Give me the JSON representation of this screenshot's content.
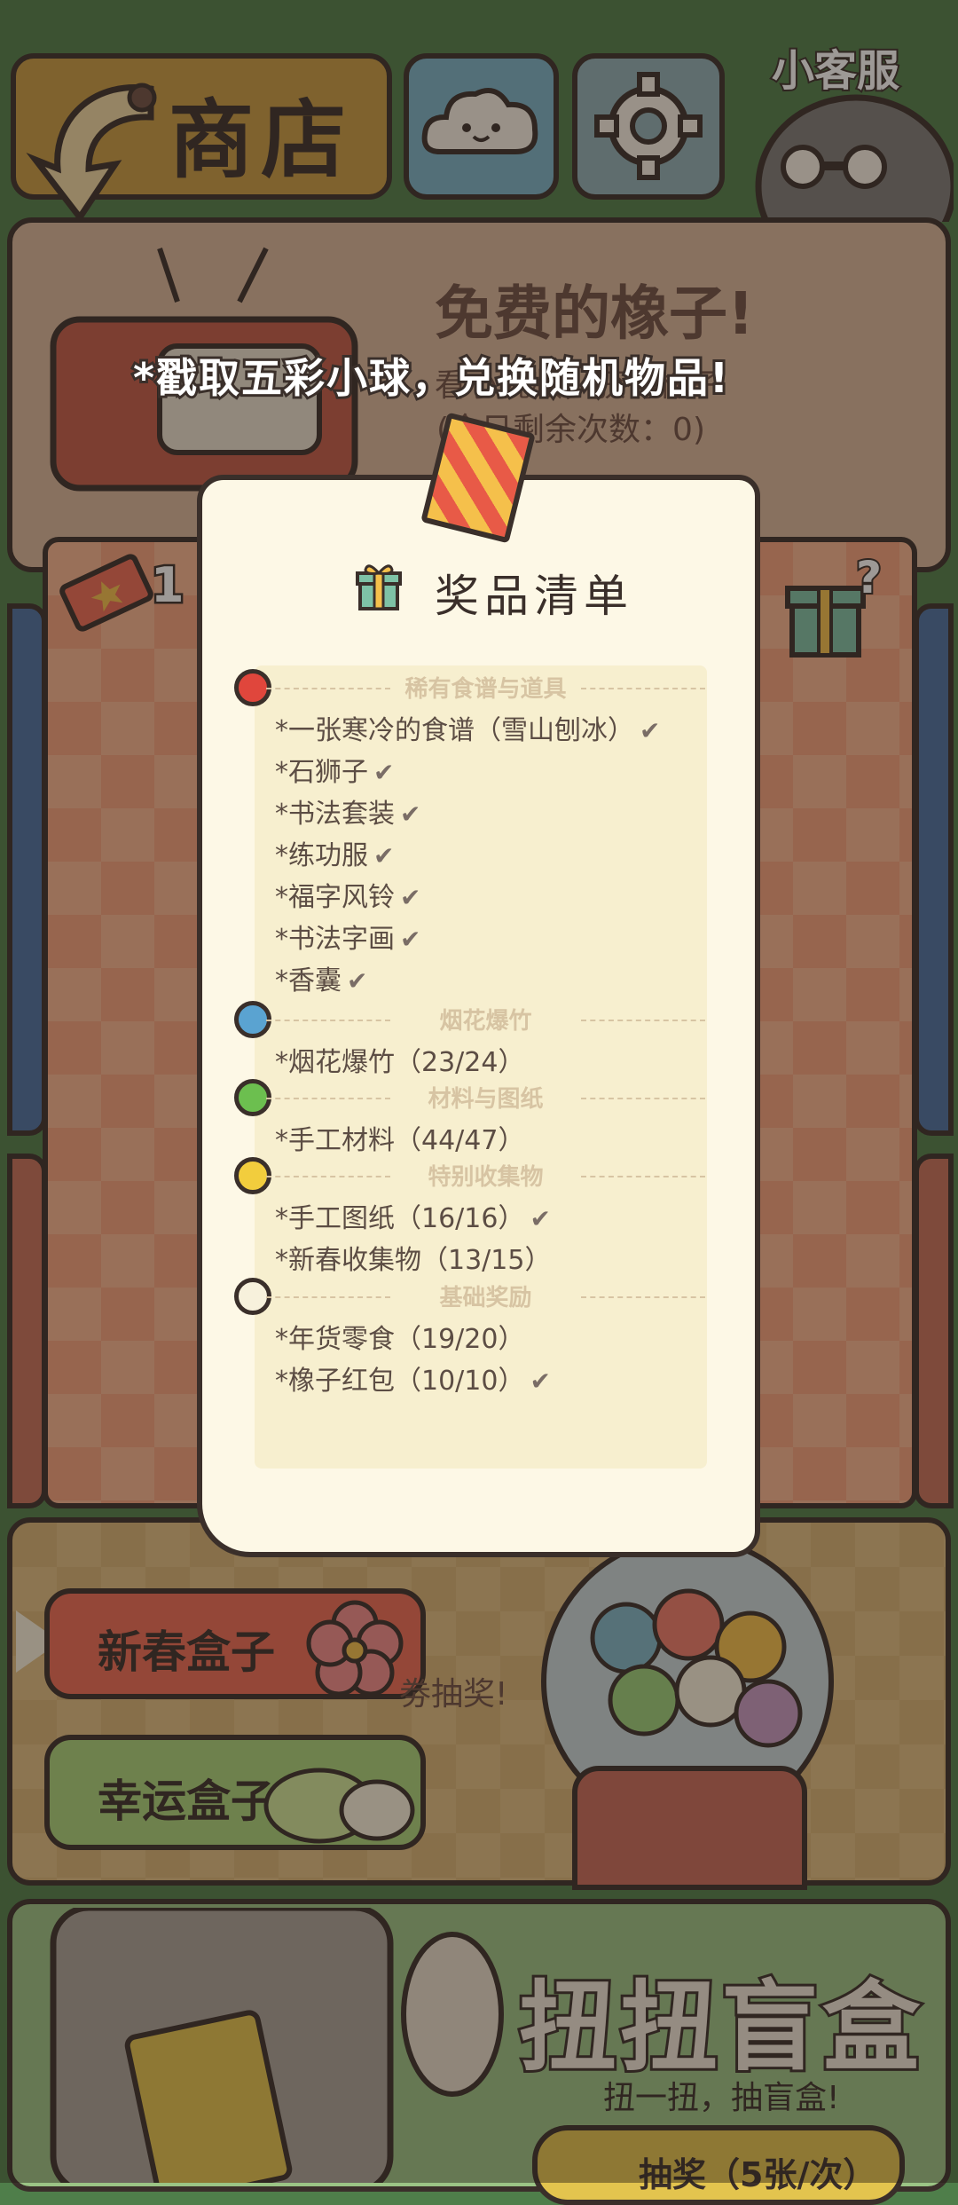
{
  "topbar": {
    "shop_label": "商店",
    "customer_service_label": "小客服"
  },
  "acorn_panel": {
    "title": "免费的橡子!",
    "subtitle": "看小视频，获得橡子",
    "remaining": "(今日剩余次数：0)"
  },
  "banner": "*戳取五彩小球，兑换随机物品!",
  "ticket_count": "1",
  "modal": {
    "title": "奖品清单",
    "sections": [
      {
        "heading": "稀有食谱与道具",
        "dot_color": "#e0463c",
        "items": [
          {
            "text": "*一张寒冷的食谱（雪山刨冰）",
            "done": "✔"
          },
          {
            "text": "*石狮子",
            "done": "✔"
          },
          {
            "text": "*书法套装",
            "done": "✔"
          },
          {
            "text": "*练功服",
            "done": "✔"
          },
          {
            "text": "*福字风铃",
            "done": "✔"
          },
          {
            "text": "*书法字画",
            "done": "✔"
          },
          {
            "text": "*香囊",
            "done": "✔"
          }
        ]
      },
      {
        "heading": "烟花爆竹",
        "dot_color": "#5aa3d1",
        "items": [
          {
            "text": "*烟花爆竹（23/24）",
            "done": ""
          }
        ]
      },
      {
        "heading": "材料与图纸",
        "dot_color": "#6cbf4f",
        "items": [
          {
            "text": "*手工材料（44/47）",
            "done": ""
          }
        ]
      },
      {
        "heading": "特别收集物",
        "dot_color": "#f2cd3d",
        "items": [
          {
            "text": "*手工图纸（16/16）",
            "done": "✔"
          },
          {
            "text": "*新春收集物（13/15）",
            "done": ""
          }
        ]
      },
      {
        "heading": "基础奖励",
        "dot_color": "#f7f1dc",
        "items": [
          {
            "text": "*年货零食（19/20）",
            "done": ""
          },
          {
            "text": "*橡子红包（10/10）",
            "done": "✔"
          }
        ]
      }
    ]
  },
  "boxes": {
    "spring_label": "新春盒子",
    "lucky_label": "幸运盒子",
    "hint": "劵抽奖!"
  },
  "blind_box": {
    "title": "扭扭盲盒",
    "subtitle": "扭一扭，抽盲盒!",
    "draw_label": "抽奖（5张/次）"
  },
  "colors": {
    "outline": "#3a2f2a",
    "paper": "#fdf8e6"
  }
}
